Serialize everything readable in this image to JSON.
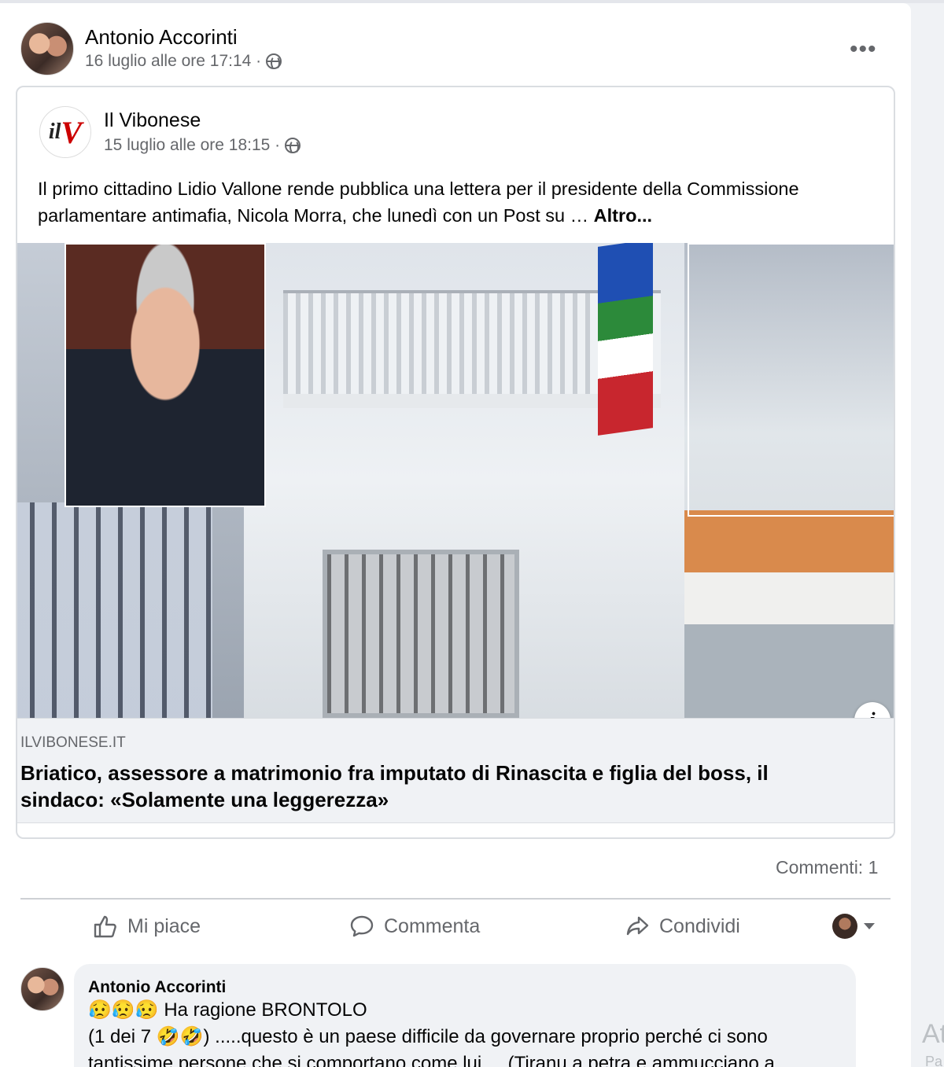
{
  "post": {
    "author": "Antonio Accorinti",
    "timestamp": "16 luglio alle ore 17:14 ·",
    "privacy_icon": "globe-icon",
    "options_label": "•••"
  },
  "shared": {
    "page_name": "Il Vibonese",
    "logo_text_a": "il",
    "logo_text_b": "V",
    "timestamp": "15 luglio alle ore 18:15 ·",
    "text": "Il primo cittadino Lidio Vallone rende pubblica una lettera per il presidente della Commissione parlamentare antimafia, Nicola Morra, che lunedì con un Post su … ",
    "more_label": "Altro...",
    "info_label": "i",
    "link_domain": "ILVIBONESE.IT",
    "link_title": "Briatico, assessore a matrimonio fra imputato di Rinascita e figlia del boss, il sindaco: «Solamente una leggerezza»"
  },
  "stats": {
    "comments": "Commenti: 1"
  },
  "actions": {
    "like": "Mi piace",
    "comment": "Commenta",
    "share": "Condividi"
  },
  "comment": {
    "author": "Antonio Accorinti",
    "line1": "😥😥😥 Ha ragione BRONTOLO",
    "line2": "(1 dei 7 🤣🤣) .....questo è un paese difficile da governare proprio perché ci sono",
    "line3": "tantissime persone che si comportano come lui.... (Tiranu a petra e ammucciano a"
  },
  "side": {
    "text1": "At",
    "text2": "Pa"
  },
  "colors": {
    "text_primary": "#050505",
    "text_secondary": "#65676b",
    "background": "#f0f2f5",
    "brand_red": "#cc0000"
  }
}
